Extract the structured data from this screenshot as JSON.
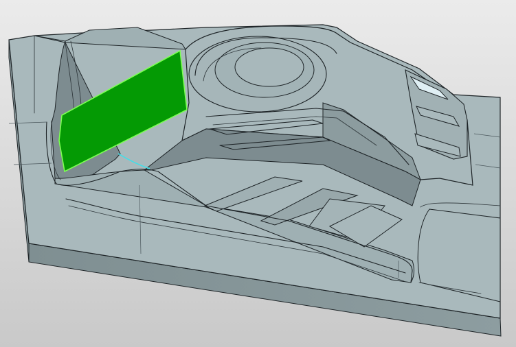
{
  "viewport": {
    "background_top": "#ebebeb",
    "background_bottom": "#c9c9c9"
  },
  "model": {
    "body_color": "#9fb0b3",
    "top_color": "#a9b9bc",
    "side_color": "#8c9c9f",
    "front_color": "#869699",
    "shadow_color": "#7d8c90",
    "edge_color": "#1d2326",
    "selected_face": {
      "color": "#049a04",
      "edge_color": "#7cff52"
    },
    "highlighted_edge": {
      "color": "#3fe0ea"
    },
    "slot_color": "#dfeff4"
  }
}
